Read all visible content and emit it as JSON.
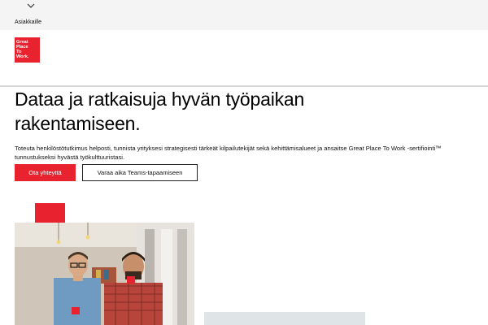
{
  "topbar": {
    "audience_label": "Asiakkaille",
    "chevron_icon": "chevron-down-icon"
  },
  "logo": {
    "lines": [
      "Great",
      "Place",
      "To",
      "Work."
    ],
    "color": "#e8222e"
  },
  "hero": {
    "title": "Dataa ja ratkaisuja hyvän työpaikan rakentamiseen.",
    "description": "Toteuta henkilöstötutkimus helposti, tunnista yrityksesi strategisesti tärkeät kilpailutekijät sekä kehittämisalueet ja ansaitse Great Place To Work -sertifiointi™ tunnustukseksi hyvästä työkulttuuristasi.",
    "primary_button": "Ota yhteyttä",
    "secondary_button": "Varaa aika Teams-tapaamiseen"
  },
  "colors": {
    "brand_red": "#e8222e",
    "topbar_bg": "#f4f4f4"
  }
}
